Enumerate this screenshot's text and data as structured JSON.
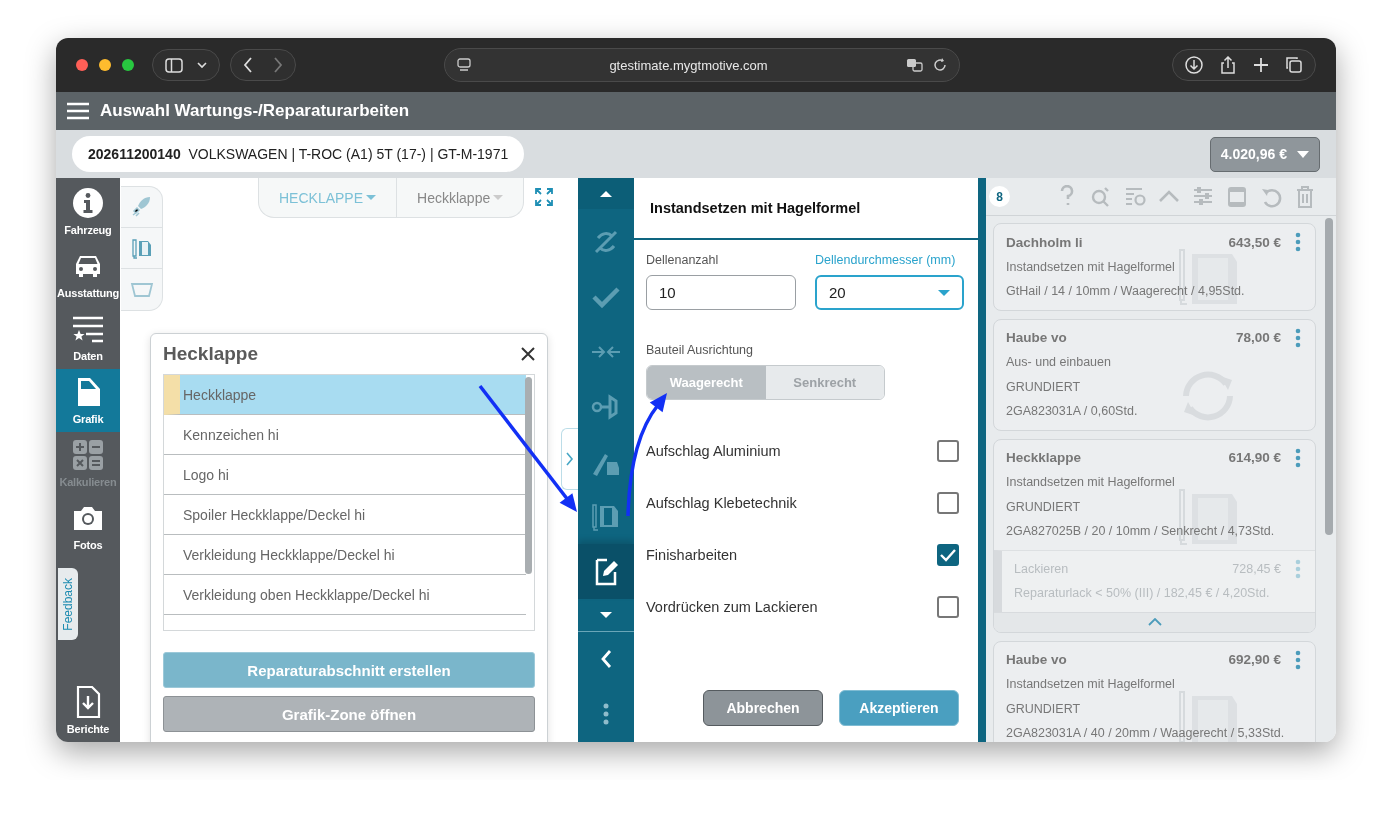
{
  "browser": {
    "url": "gtestimate.mygtmotive.com"
  },
  "header": {
    "title": "Auswahl Wartungs-/Reparaturarbeiten"
  },
  "vehicle": {
    "summary": "**202611200140**  VOLKSWAGEN | T-ROC (A1) 5T (17-) | GT-M-1971",
    "total": "4.020,96 €"
  },
  "nav": {
    "items": [
      {
        "label": "Fahrzeug",
        "selected": false,
        "disabled": false
      },
      {
        "label": "Ausstattung",
        "selected": false,
        "disabled": false
      },
      {
        "label": "Daten",
        "selected": false,
        "disabled": false
      },
      {
        "label": "Grafik",
        "selected": true,
        "disabled": false
      },
      {
        "label": "Kalkulieren",
        "selected": false,
        "disabled": true
      },
      {
        "label": "Fotos",
        "selected": false,
        "disabled": false
      },
      {
        "label": "Berichte",
        "selected": false,
        "disabled": false
      }
    ],
    "feedback": "Feedback"
  },
  "graphic": {
    "zone_select": "HECKLAPPE",
    "part_select": "Heckklappe"
  },
  "part_popup": {
    "title": "Hecklappe",
    "items": [
      {
        "label": "Heckklappe",
        "selected": true
      },
      {
        "label": "Kennzeichen hi",
        "selected": false
      },
      {
        "label": "Logo hi",
        "selected": false
      },
      {
        "label": "Spoiler Heckklappe/Deckel hi",
        "selected": false
      },
      {
        "label": "Verkleidung Heckklappe/Deckel hi",
        "selected": false
      },
      {
        "label": "Verkleidung oben Heckklappe/Deckel hi",
        "selected": false
      }
    ],
    "buttons": [
      {
        "label": "Reparaturabschnitt erstellen",
        "kind": "primary"
      },
      {
        "label": "Grafik-Zone öffnen",
        "kind": "secondary"
      }
    ]
  },
  "tool_rail": {
    "items": [
      {
        "selected": false
      },
      {
        "selected": false
      },
      {
        "selected": false
      },
      {
        "selected": false
      },
      {
        "selected": false
      },
      {
        "selected": false
      },
      {
        "selected": true
      }
    ]
  },
  "hail_form": {
    "title": "Instandsetzen mit Hagelformel",
    "dent_count": {
      "label": "Dellenanzahl",
      "value": "10"
    },
    "dent_diameter": {
      "label": "Dellendurchmesser (mm)",
      "value": "20"
    },
    "orientation": {
      "label": "Bauteil Ausrichtung",
      "options": [
        {
          "label": "Waagerecht",
          "selected": true
        },
        {
          "label": "Senkrecht",
          "selected": false
        }
      ]
    },
    "options": [
      {
        "label": "Aufschlag Aluminium",
        "checked": false
      },
      {
        "label": "Aufschlag Klebetechnik",
        "checked": false
      },
      {
        "label": "Finisharbeiten",
        "checked": true
      },
      {
        "label": "Vordrücken zum Lackieren",
        "checked": false
      }
    ],
    "buttons": [
      {
        "label": "Abbrechen",
        "kind": "secondary"
      },
      {
        "label": "Akzeptieren",
        "kind": "primary"
      }
    ]
  },
  "jobs": {
    "count": "8",
    "cards": [
      {
        "kind": "repair",
        "part": "Dachholm li",
        "price": "643,50 €",
        "lines": [
          "Instandsetzen mit Hagelformel",
          "GtHail / 14 / 10mm / Waagerecht / 4,95Std."
        ]
      },
      {
        "kind": "replace",
        "part": "Haube vo",
        "price": "78,00 €",
        "lines": [
          "Aus- und einbauen",
          "GRUNDIERT",
          "2GA823031A / 0,60Std."
        ]
      },
      {
        "kind": "repair",
        "part": "Heckklappe",
        "price": "614,90 €",
        "lines": [
          "Instandsetzen mit Hagelformel",
          "GRUNDIERT",
          "2GA827025B / 20 / 10mm / Senkrecht / 4,73Std."
        ],
        "expanded": true,
        "sub_items": [
          {
            "title": "Lackieren",
            "price": "728,45 €",
            "detail": "Reparaturlack < 50% (III) / 182,45 € / 4,20Std."
          }
        ]
      },
      {
        "kind": "repair",
        "part": "Haube vo",
        "price": "692,90 €",
        "lines": [
          "Instandsetzen mit Hagelformel",
          "GRUNDIERT",
          "2GA823031A / 40 / 20mm / Waagerecht / 5,33Std."
        ]
      }
    ]
  }
}
